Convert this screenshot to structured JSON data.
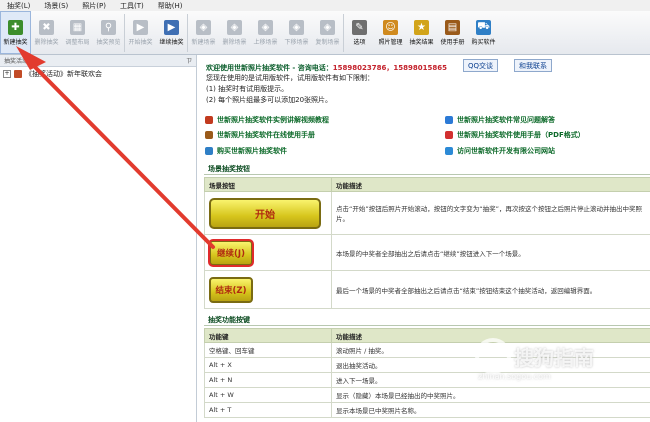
{
  "menu": [
    "抽奖(L)",
    "场景(S)",
    "照片(P)",
    "工具(T)",
    "帮助(H)"
  ],
  "toolbar": [
    {
      "label": "新建抽奖",
      "icon": "new-lottery-icon",
      "enabled": true,
      "color": "#3c8d2c"
    },
    {
      "label": "删除抽奖",
      "icon": "delete-lottery-icon",
      "enabled": false,
      "color": "#b8bec6"
    },
    {
      "label": "调整布局",
      "icon": "layout-icon",
      "enabled": false,
      "color": "#b8bec6"
    },
    {
      "label": "抽奖预览",
      "icon": "preview-icon",
      "enabled": false,
      "color": "#b8bec6"
    },
    {
      "label": "开始抽奖",
      "icon": "play-icon",
      "enabled": false,
      "color": "#b8bec6"
    },
    {
      "label": "继续抽奖",
      "icon": "continue-icon",
      "enabled": true,
      "color": "#3f6fb3"
    },
    {
      "label": "新建场景",
      "icon": "new-scene-icon",
      "enabled": false,
      "color": "#b8bec6"
    },
    {
      "label": "删除场景",
      "icon": "delete-scene-icon",
      "enabled": false,
      "color": "#b8bec6"
    },
    {
      "label": "上移场景",
      "icon": "move-up-icon",
      "enabled": false,
      "color": "#b8bec6"
    },
    {
      "label": "下移场景",
      "icon": "move-down-icon",
      "enabled": false,
      "color": "#b8bec6"
    },
    {
      "label": "复制场景",
      "icon": "copy-scene-icon",
      "enabled": false,
      "color": "#b8bec6"
    },
    {
      "label": "选项",
      "icon": "wrench-icon",
      "enabled": true,
      "color": "#6f6f6f"
    },
    {
      "label": "照片管理",
      "icon": "people-icon",
      "enabled": true,
      "color": "#d08a1e"
    },
    {
      "label": "抽奖结果",
      "icon": "medal-icon",
      "enabled": true,
      "color": "#d2a41a"
    },
    {
      "label": "使用手册",
      "icon": "book-icon",
      "enabled": true,
      "color": "#9a5a1a"
    },
    {
      "label": "购买软件",
      "icon": "cart-icon",
      "enabled": true,
      "color": "#2f7fc6"
    }
  ],
  "left_panel": {
    "header": "抽奖活动",
    "pin": "ㄗ",
    "items": [
      {
        "label": "《抽奖活动》新年联欢会",
        "expander": "+"
      }
    ]
  },
  "main": {
    "welcome": "欢迎使用世新照片抽奖软件 - 咨询电话：",
    "phones": "15898023786，15898015865",
    "qq_label": "QQ交谈",
    "contact_label": "和我联系",
    "notice_lines": [
      "您现在使用的是试用版软件，试用版软件有如下限制：",
      "(1) 抽奖时有试用版提示。",
      "(2) 每个照片组最多可以添加20张照片。"
    ],
    "links": [
      {
        "text": "世新照片抽奖软件实例讲解视频教程",
        "color": "#c23a1f"
      },
      {
        "text": "世新照片抽奖软件常见问题解答",
        "color": "#2c7ad6"
      },
      {
        "text": "世新照片抽奖软件在线使用手册",
        "color": "#9a5a1a"
      },
      {
        "text": "世新照片抽奖软件使用手册（PDF格式）",
        "color": "#d23030"
      },
      {
        "text": "购买世新照片抽奖软件",
        "color": "#2f7fc6"
      },
      {
        "text": "访问世新软件开发有限公司网站",
        "color": "#2c8ad6"
      }
    ],
    "scene_section": {
      "title": "场景抽奖按钮",
      "col1": "场景按钮",
      "col2": "功能描述",
      "rows": [
        {
          "button": "开始",
          "desc": "点击“开始”按钮后照片开始滚动，按钮的文字变为“抽奖”，再次按这个按钮之后照片停止滚动并抽出中奖照片。"
        },
        {
          "button": "继续(J)",
          "desc": "本场景的中奖者全部抽出之后请点击“继续”按钮进入下一个场景。"
        },
        {
          "button": "结束(Z)",
          "desc": "最后一个场景的中奖者全部抽出之后请点击“结束”按钮结束这个抽奖活动，返回编辑界面。"
        }
      ]
    },
    "keys_section": {
      "title": "抽奖功能按键",
      "col1": "功能键",
      "col2": "功能描述",
      "rows": [
        {
          "key": "空格键、回车键",
          "desc": "滚动照片 / 抽奖。"
        },
        {
          "key": "Alt + X",
          "desc": "退出抽奖活动。"
        },
        {
          "key": "Alt + N",
          "desc": "进入下一场景。"
        },
        {
          "key": "Alt + W",
          "desc": "显示（隐藏）本场景已经抽出的中奖照片。"
        },
        {
          "key": "Alt + T",
          "desc": "显示本场景已中奖照片名称。"
        }
      ]
    }
  },
  "watermark": {
    "text": "搜狗指南",
    "sub": "zhinan.sogou.com"
  }
}
